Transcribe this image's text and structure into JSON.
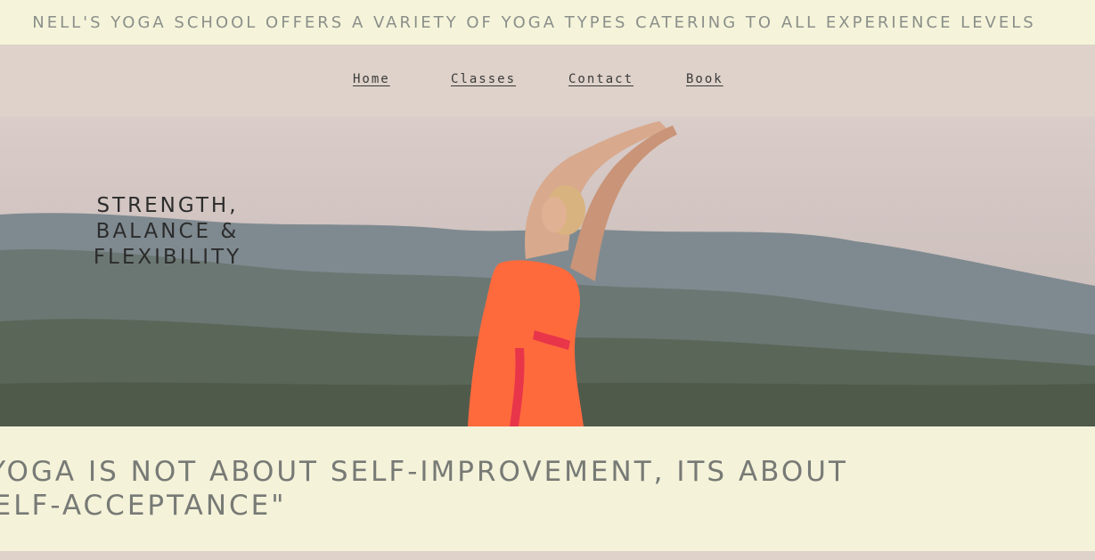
{
  "announcement": {
    "text": "NELL'S YOGA SCHOOL OFFERS A VARIETY OF YOGA TYPES CATERING TO ALL EXPERIENCE LEVELS"
  },
  "nav": {
    "items": [
      {
        "label": "Home"
      },
      {
        "label": "Classes"
      },
      {
        "label": "Contact"
      },
      {
        "label": "Book"
      }
    ]
  },
  "hero": {
    "tagline_lines": [
      "STRENGTH,",
      "BALANCE &",
      "FLEXIBILITY"
    ],
    "image_description_icon": "yoga-pose-photo"
  },
  "quote": {
    "text": "\"YOGA IS NOT ABOUT SELF-IMPROVEMENT, ITS ABOUT SELF-ACCEPTANCE\""
  },
  "colors": {
    "announcement_bg": "#f5f4da",
    "nav_bg": "#ded2ca",
    "quote_bg": "#f4f2d9",
    "text_muted": "#777a75"
  }
}
